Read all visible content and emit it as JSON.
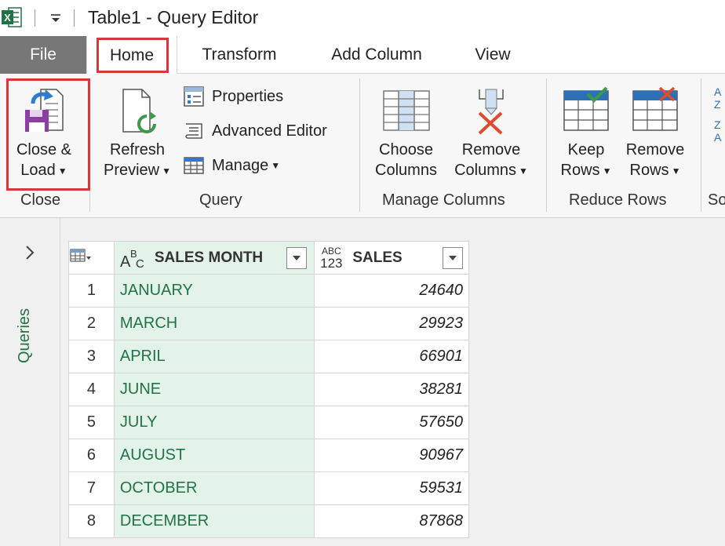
{
  "window": {
    "title": "Table1 - Query Editor",
    "app_icon": "excel-icon"
  },
  "tabs": {
    "file": "File",
    "home": "Home",
    "transform": "Transform",
    "add_column": "Add Column",
    "view": "View"
  },
  "ribbon": {
    "close_group": {
      "label": "Close",
      "close_load": [
        "Close &",
        "Load"
      ]
    },
    "query_group": {
      "label": "Query",
      "refresh_preview": [
        "Refresh",
        "Preview"
      ],
      "properties": "Properties",
      "advanced_editor": "Advanced Editor",
      "manage": "Manage"
    },
    "manage_columns_group": {
      "label": "Manage Columns",
      "choose_columns": [
        "Choose",
        "Columns"
      ],
      "remove_columns": [
        "Remove",
        "Columns"
      ]
    },
    "reduce_rows_group": {
      "label": "Reduce Rows",
      "keep_rows": [
        "Keep",
        "Rows"
      ],
      "remove_rows": [
        "Remove",
        "Rows"
      ]
    },
    "sort_group": {
      "label": "So"
    }
  },
  "queries_pane": {
    "label": "Queries"
  },
  "table": {
    "columns": [
      {
        "name": "SALES MONTH",
        "type_icon": "ABC"
      },
      {
        "name": "SALES",
        "type_icon": "ABC 123"
      }
    ],
    "rows": [
      {
        "index": "1",
        "month": "JANUARY",
        "sales": "24640"
      },
      {
        "index": "2",
        "month": "MARCH",
        "sales": "29923"
      },
      {
        "index": "3",
        "month": "APRIL",
        "sales": "66901"
      },
      {
        "index": "4",
        "month": "JUNE",
        "sales": "38281"
      },
      {
        "index": "5",
        "month": "JULY",
        "sales": "57650"
      },
      {
        "index": "6",
        "month": "AUGUST",
        "sales": "90967"
      },
      {
        "index": "7",
        "month": "OCTOBER",
        "sales": "59531"
      },
      {
        "index": "8",
        "month": "DECEMBER",
        "sales": "87868"
      }
    ]
  },
  "colors": {
    "accent_green": "#217346",
    "highlight_red": "#d9363b",
    "selected_column_bg": "#e3f3ea"
  }
}
